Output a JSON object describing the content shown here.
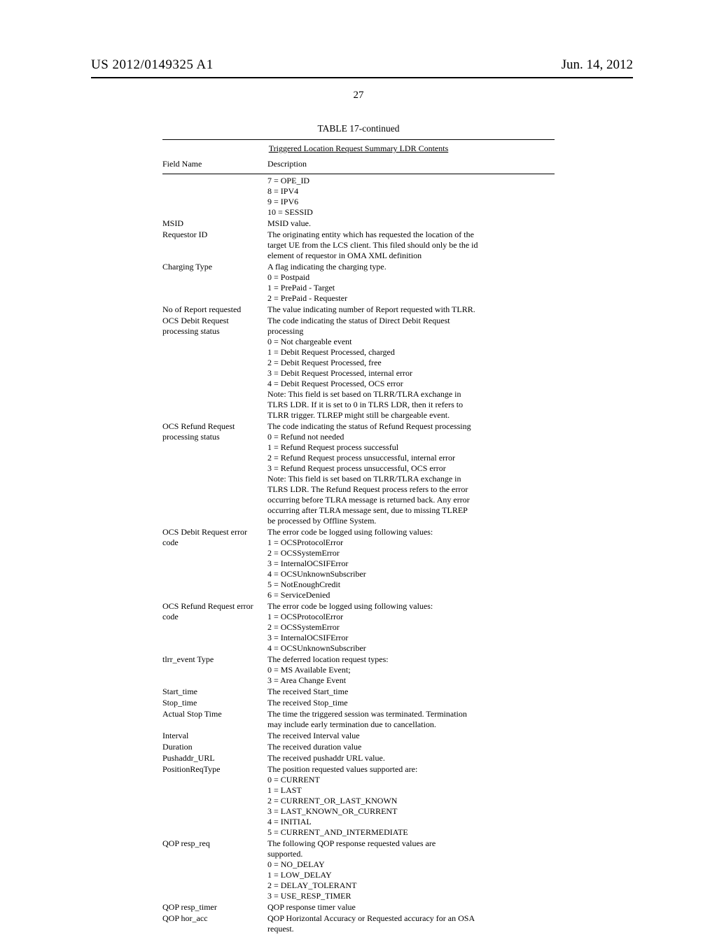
{
  "header": {
    "pub_num": "US 2012/0149325 A1",
    "pub_date": "Jun. 14, 2012",
    "page_num": "27"
  },
  "table": {
    "title": "TABLE 17-continued",
    "subtitle": "Triggered Location Request Summary LDR Contents",
    "col_field": "Field Name",
    "col_desc": "Description",
    "rows": [
      {
        "field": "",
        "desc": [
          "7 = OPE_ID",
          "8 = IPV4",
          "9 = IPV6",
          "10 = SESSID"
        ]
      },
      {
        "field": "MSID",
        "desc": [
          "MSID value."
        ]
      },
      {
        "field": "Requestor ID",
        "desc": [
          "The originating entity which has requested the location of the",
          "target UE from the LCS client. This filed should only be the id",
          "element of requestor in OMA XML definition"
        ]
      },
      {
        "field": "Charging Type",
        "desc": [
          "A flag indicating the charging type.",
          "0 = Postpaid",
          "1 = PrePaid - Target",
          "2 = PrePaid - Requester"
        ]
      },
      {
        "field": "No of Report requested",
        "desc": [
          "The value indicating number of Report requested with TLRR."
        ]
      },
      {
        "field": "OCS Debit Request processing status",
        "desc": [
          "The code indicating the status of Direct Debit Request",
          "processing",
          "0 = Not chargeable event",
          "1 = Debit Request Processed, charged",
          "2 = Debit Request Processed, free",
          "3 = Debit Request Processed, internal error",
          "4 = Debit Request Processed, OCS error",
          "Note: This field is set based on TLRR/TLRA exchange in",
          "TLRS LDR. If it is set to 0 in TLRS LDR, then it refers to",
          "TLRR trigger. TLREP might still be chargeable event."
        ]
      },
      {
        "field": "OCS Refund Request processing status",
        "desc": [
          "The code indicating the status of Refund Request processing",
          "0 = Refund not needed",
          "1 = Refund Request process successful",
          "2 = Refund Request process unsuccessful, internal error",
          "3 = Refund Request process unsuccessful, OCS error",
          "Note: This field is set based on TLRR/TLRA exchange in",
          "TLRS LDR. The Refund Request process refers to the error",
          "occurring before TLRA message is returned back. Any error",
          "occurring after TLRA message sent, due to missing TLREP",
          "be processed by Offline System."
        ]
      },
      {
        "field": "OCS Debit Request error code",
        "desc": [
          "The error code be logged using following values:",
          "1 = OCSProtocolError",
          "2 = OCSSystemError",
          "3 = InternalOCSIFError",
          "4 = OCSUnknownSubscriber",
          "5 = NotEnoughCredit",
          "6 = ServiceDenied"
        ]
      },
      {
        "field": "OCS Refund Request error code",
        "desc": [
          "The error code be logged using following values:",
          "1 = OCSProtocolError",
          "2 = OCSSystemError",
          "3 = InternalOCSIFError",
          "4 = OCSUnknownSubscriber"
        ]
      },
      {
        "field": "tlrr_event Type",
        "desc": [
          "The deferred location request types:",
          "0 = MS Available Event;",
          "3 = Area Change Event"
        ]
      },
      {
        "field": "Start_time",
        "desc": [
          "The received Start_time"
        ]
      },
      {
        "field": "Stop_time",
        "desc": [
          "The received Stop_time"
        ]
      },
      {
        "field": "Actual Stop Time",
        "desc": [
          "The time the triggered session was terminated. Termination",
          "may include early termination due to cancellation."
        ]
      },
      {
        "field": "Interval",
        "desc": [
          "The received Interval value"
        ]
      },
      {
        "field": "Duration",
        "desc": [
          "The received duration value"
        ]
      },
      {
        "field": "Pushaddr_URL",
        "desc": [
          "The received pushaddr URL value."
        ]
      },
      {
        "field": "PositionReqType",
        "desc": [
          "The position requested values supported are:",
          "0 = CURRENT",
          "1 = LAST",
          "2 = CURRENT_OR_LAST_KNOWN",
          "3 = LAST_KNOWN_OR_CURRENT",
          "4 = INITIAL",
          "5 = CURRENT_AND_INTERMEDIATE"
        ]
      },
      {
        "field": "QOP resp_req",
        "desc": [
          "The following QOP response requested values are",
          "supported.",
          "0 = NO_DELAY",
          "1 = LOW_DELAY",
          "2 = DELAY_TOLERANT",
          "3 = USE_RESP_TIMER"
        ]
      },
      {
        "field": "QOP resp_timer",
        "desc": [
          "QOP response timer value"
        ]
      },
      {
        "field": "QOP hor_acc",
        "desc": [
          "QOP Horizontal Accuracy or Requested accuracy for an OSA",
          "request."
        ]
      }
    ]
  }
}
